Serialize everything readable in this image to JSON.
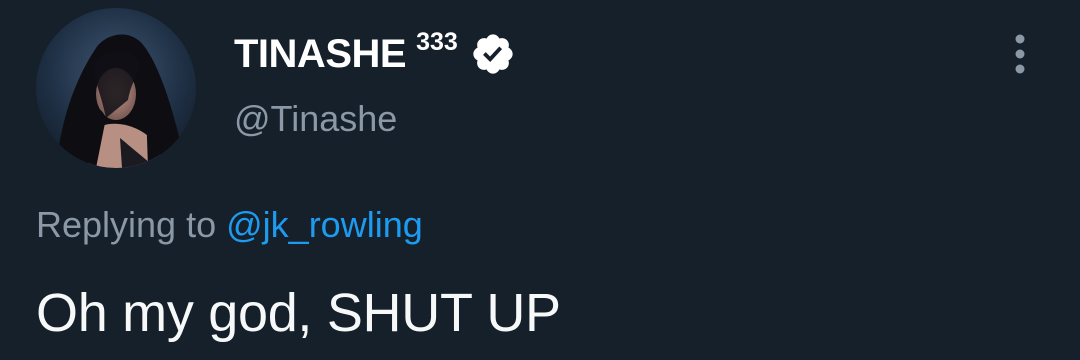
{
  "author": {
    "display_name": "TINASHE",
    "name_suffix": "333",
    "handle": "@Tinashe",
    "verified": true,
    "avatar_icon": "profile-photo"
  },
  "reply_context": {
    "prefix": "Replying to",
    "mention": "@jk_rowling"
  },
  "tweet": {
    "text": "Oh my god, SHUT UP"
  },
  "icons": {
    "verified": "verified-badge-icon",
    "more": "more-vertical-icon"
  },
  "colors": {
    "background": "#15202b",
    "primary_text": "#f7f9f9",
    "secondary_text": "#8b98a5",
    "accent": "#1d9bf0"
  }
}
